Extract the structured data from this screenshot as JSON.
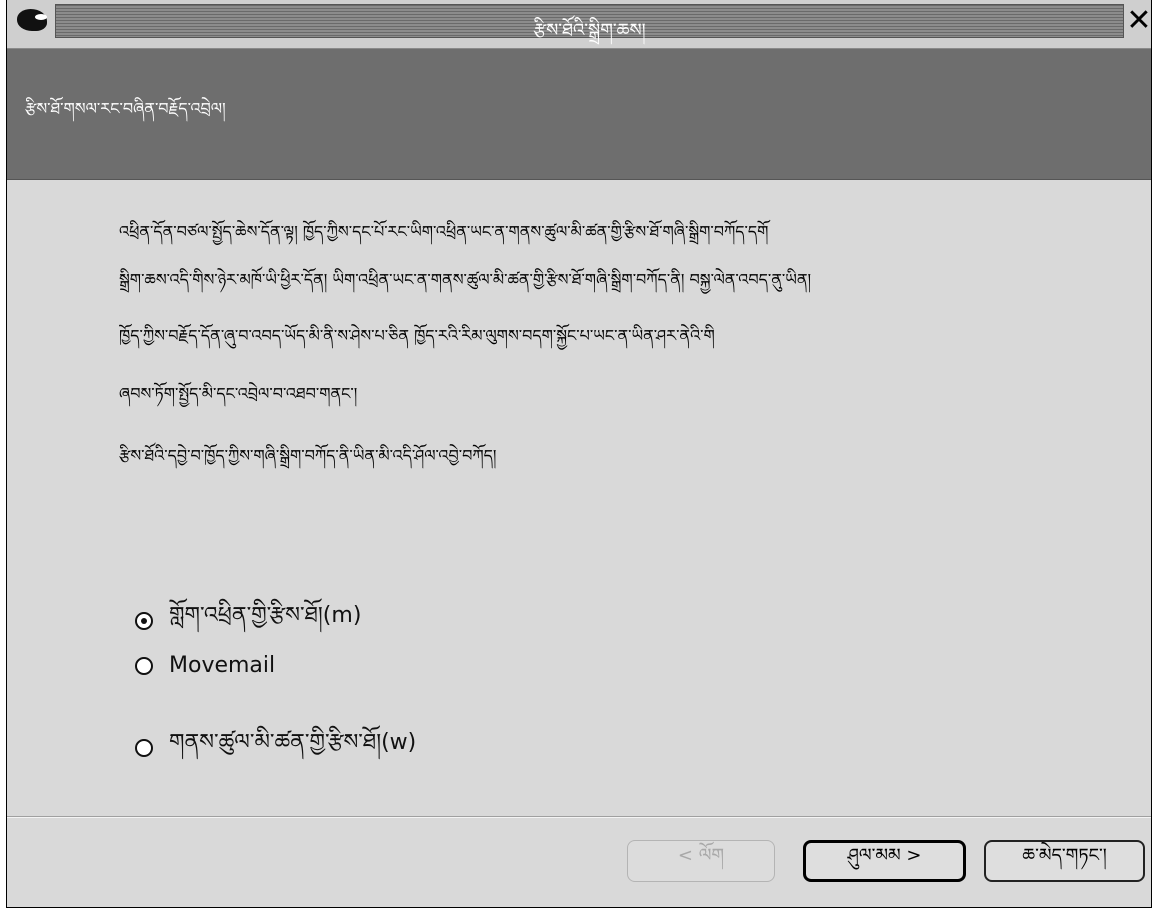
{
  "window": {
    "title": "རྩིས་ཐོའི་སྒྲིག་ཆས།",
    "close_label": "✕"
  },
  "header": {
    "title": "རྩིས་ཐོ་གསལ་རང་བཞིན་བརྗོད་འབྲེལ།"
  },
  "description": {
    "line1": "འཕྲིན་དོན་བཙལ་སྤྱོད་ཆེས་དོན་ལྟ། ཁྱོད་ཀྱིས་དང་པོ་རང་ཡིག་འཕྲིན་ཡང་ན་གནས་ཚུལ་མི་ཚན་གྱི་རྩིས་ཐོ་གཞི་སྒྲིག་བཀོད་དགོ",
    "line2": "སྒྲིག་ཆས་འདི་གིས་ཉེར་མཁོ་ཡི་ཕྱིར་དོན། ཡིག་འཕྲིན་ཡང་ན་གནས་ཚུལ་མི་ཚན་གྱི་རྩིས་ཐོ་གཞི་སྒྲིག་བཀོད་ནི། བསྐྱ་ལེན་འབད་ནུ་ཡིན།",
    "line3": "ཁྱོད་ཀྱིས་བརྗོད་དོན་ཞུ་བ་འབད་ཡོད་མི་ནི་ས་ཤེས་པ་ཅིན ཁྱོད་རའི་རིམ་ལུགས་བདག་སྐྱོང་པ་ཡང་ན་ཡིན་ཤར་ནེའི་གི",
    "line4": "ཞབས་ཏོག་སྤྱོད་མི་དང་འབྲེལ་བ་འཐབ་གནང་།",
    "line5": "རྩིས་ཐོའི་དབྱེ་བ་ཁྱོད་ཀྱིས་གཞི་སྒྲིག་བཀོད་ནི་ཡིན་མི་འདི་ཤོལ་འབྱེ་བཀོད།"
  },
  "options": [
    {
      "label": "གློག་འཕྲིན་གྱི་རྩིས་ཐོ།(m)",
      "selected": true
    },
    {
      "label": "Movemail",
      "selected": false
    },
    {
      "label": "གནས་ཚུལ་མི་ཚན་གྱི་རྩིས་ཐོ།(w)",
      "selected": false
    }
  ],
  "buttons": {
    "back": "< ལོག",
    "next": "ཤུལ་མམ >",
    "cancel": "ཆ་མེད་གཏང་།"
  },
  "colors": {
    "window_bg": "#d9d9d9",
    "header_bg": "#6e6e6e",
    "title_stripe": "#7a7a7a"
  }
}
